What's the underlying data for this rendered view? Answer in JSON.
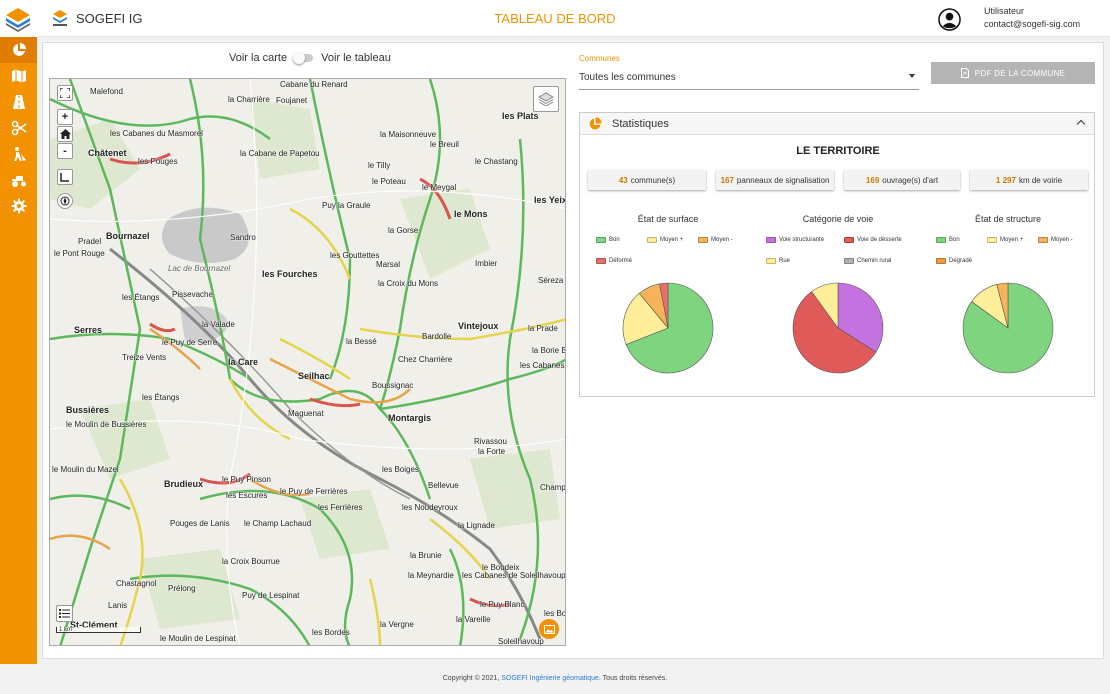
{
  "header": {
    "app_name": "SOGEFI IG",
    "page_title": "TABLEAU DE BORD",
    "user_role": "Utilisateur",
    "user_email": "contact@sogefi-sig.com"
  },
  "sidebar": {
    "items": [
      {
        "icon": "pie-chart-icon",
        "active": true
      },
      {
        "icon": "map-icon",
        "active": false
      },
      {
        "icon": "road-icon",
        "active": false
      },
      {
        "icon": "scissors-icon",
        "active": false
      },
      {
        "icon": "worker-icon",
        "active": false
      },
      {
        "icon": "roller-icon",
        "active": false
      },
      {
        "icon": "gear-icon",
        "active": false
      }
    ]
  },
  "view_toggle": {
    "left_label": "Voir la carte",
    "right_label": "Voir le tableau"
  },
  "map": {
    "scale_label": "1 km",
    "labels": [
      "Malefond",
      "la Charrière",
      "Cabane du Renard",
      "Foujanet",
      "la Maisonneuve",
      "le Breuil",
      "les Plats",
      "les Cabanes du Masmorel",
      "Châtenet",
      "les Pouges",
      "la Cabane de Papetou",
      "le Tilly",
      "le Chastang",
      "le Poteau",
      "le Meygal",
      "Puy la Graule",
      "le Mons",
      "les Yeix",
      "Bournazel",
      "Sandro",
      "la Gorse",
      "Pradel",
      "le Pont Rouge",
      "Lac de Bournazel",
      "les Gouttettes",
      "Marsal",
      "Imbier",
      "les Fourches",
      "la Croix du Mons",
      "Séreza",
      "les Étangs",
      "Pissevache",
      "Serres",
      "la Valade",
      "Bardolle",
      "Vintejoux",
      "la Prade",
      "le Puy de Serre",
      "Treize Vents",
      "la Bessé",
      "la Borie Blanche",
      "la Care",
      "Chez Charrière",
      "les Cabanes de Maurie",
      "Seilhac",
      "Boussignac",
      "Bussières",
      "les Étangs",
      "Maguenat",
      "Montargis",
      "le Moulin de Bussières",
      "Rivassou",
      "la Forte",
      "les Boiges",
      "le Moulin du Mazel",
      "le Puy Pinson",
      "Bellevue",
      "Champ",
      "Brudieux",
      "les Escures",
      "le Puy de Ferrières",
      "les Ferrières",
      "les Noudeyroux",
      "Pouges de Lanis",
      "le Champ Lachaud",
      "la Lignade",
      "la Brunie",
      "la Croix Bourrue",
      "Chastagnol",
      "la Meynardie",
      "les Cabanes de Soleilhavoup",
      "le Boudeix",
      "Prélong",
      "Puy de Lespinat",
      "le Puy Blanc",
      "Lanis",
      "St-Clément",
      "la Vareille",
      "la Vergne",
      "les Bordes",
      "le Moulin de Lespinat",
      "Soleilhavoup",
      "les Bo"
    ]
  },
  "filter": {
    "label": "Communes",
    "value": "Toutes les communes",
    "pdf_button": "PDF DE LA COMMUNE"
  },
  "statistics": {
    "title": "Statistiques",
    "territory_title": "LE TERRITOIRE",
    "kpis": [
      {
        "value": "43",
        "label": "commune(s)"
      },
      {
        "value": "167",
        "label": "panneaux de signalisation"
      },
      {
        "value": "169",
        "label": "ouvrage(s) d'art"
      },
      {
        "value": "1 297",
        "label": "km de voirie"
      }
    ],
    "charts": [
      {
        "title": "État de surface",
        "legend": [
          {
            "label": "Bon",
            "color": "#7fd47f"
          },
          {
            "label": "Moyen +",
            "color": "#ffee99"
          },
          {
            "label": "Moyen -",
            "color": "#f5b35a"
          },
          {
            "label": "Déformé",
            "color": "#e8706a"
          }
        ]
      },
      {
        "title": "Catégorie de voie",
        "legend": [
          {
            "label": "Voie structurante",
            "color": "#c472e0"
          },
          {
            "label": "Voie de désserte",
            "color": "#e05a5a"
          },
          {
            "label": "Rue",
            "color": "#ffee99"
          },
          {
            "label": "Chemin rural",
            "color": "#b0b0b0"
          }
        ]
      },
      {
        "title": "État de structure",
        "legend": [
          {
            "label": "Bon",
            "color": "#7fd47f"
          },
          {
            "label": "Moyen +",
            "color": "#ffee99"
          },
          {
            "label": "Moyen -",
            "color": "#f5b35a"
          },
          {
            "label": "Dégradé",
            "color": "#f09a3e"
          }
        ]
      }
    ]
  },
  "chart_data": [
    {
      "type": "pie",
      "title": "État de surface",
      "categories": [
        "Bon",
        "Moyen +",
        "Moyen -",
        "Déformé"
      ],
      "values": [
        69,
        20,
        8,
        3
      ],
      "colors": [
        "#7fd47f",
        "#ffee99",
        "#f5b35a",
        "#e8706a"
      ]
    },
    {
      "type": "pie",
      "title": "Catégorie de voie",
      "categories": [
        "Voie structurante",
        "Voie de désserte",
        "Rue",
        "Chemin rural"
      ],
      "values": [
        34,
        56,
        10,
        0
      ],
      "colors": [
        "#c472e0",
        "#e05a5a",
        "#ffee99",
        "#b0b0b0"
      ]
    },
    {
      "type": "pie",
      "title": "État de structure",
      "categories": [
        "Bon",
        "Moyen +",
        "Moyen -",
        "Dégradé"
      ],
      "values": [
        85,
        11,
        4,
        0
      ],
      "colors": [
        "#7fd47f",
        "#ffee99",
        "#f5b35a",
        "#f09a3e"
      ]
    }
  ],
  "footer": {
    "prefix": "Copyright © 2021,",
    "link": "SOGEFI Ingénierie géomatique",
    "suffix": ". Tous droits réservés."
  }
}
